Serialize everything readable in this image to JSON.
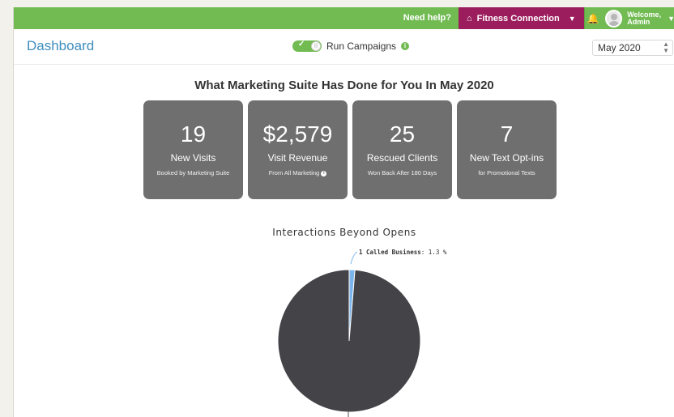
{
  "topbar": {
    "help": "Need help?",
    "business": "Fitness Connection",
    "welcome_line1": "Welcome,",
    "welcome_line2": "Admin"
  },
  "header": {
    "title": "Dashboard",
    "campaigns_label": "Run Campaigns",
    "month": "May 2020"
  },
  "summary": {
    "title": "What Marketing Suite Has Done for You In May 2020",
    "cards": [
      {
        "value": "19",
        "label": "New Visits",
        "sub": "Booked by Marketing Suite"
      },
      {
        "value": "$2,579",
        "label": "Visit Revenue",
        "sub": "From All Marketing"
      },
      {
        "value": "25",
        "label": "Rescued Clients",
        "sub": "Won Back After 180 Days"
      },
      {
        "value": "7",
        "label": "New Text Opt-ins",
        "sub": "for Promotional Texts"
      }
    ]
  },
  "colors": {
    "green": "#72bb53",
    "magenta": "#9b1d5d",
    "card": "#6f6f6f",
    "title_blue": "#3f8ebe"
  },
  "chart_data": {
    "type": "pie",
    "title": "Interactions Beyond Opens",
    "slices": [
      {
        "label": "Called Business",
        "count": 1,
        "percent": 1.3,
        "color": "#7cb5ec"
      },
      {
        "label": "",
        "count": null,
        "percent": 98.7,
        "color": "#434348"
      }
    ],
    "callout_label": "1 Called Business",
    "callout_value": ": 1.3 %"
  }
}
